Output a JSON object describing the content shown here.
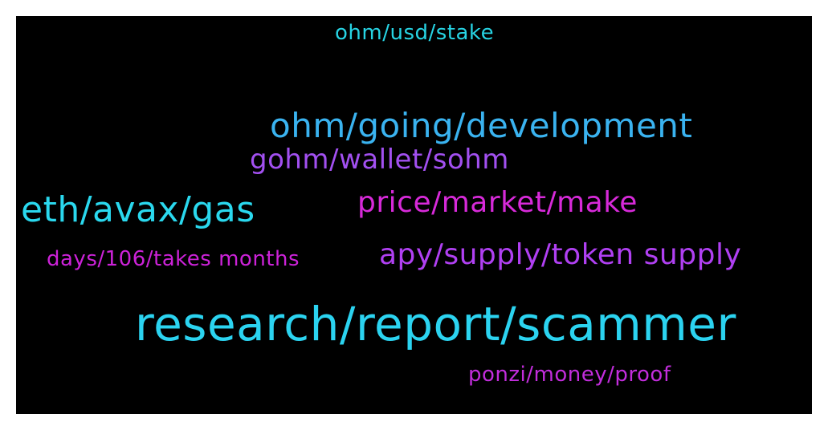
{
  "words": [
    {
      "text": "ohm/usd/stake",
      "color": "#27d3e3"
    },
    {
      "text": "ohm/going/development",
      "color": "#3ab3f0"
    },
    {
      "text": "gohm/wallet/sohm",
      "color": "#a250f0"
    },
    {
      "text": "eth/avax/gas",
      "color": "#2ad8ee"
    },
    {
      "text": "price/market/make",
      "color": "#d72ad9"
    },
    {
      "text": "days/106/takes months",
      "color": "#cc22d8"
    },
    {
      "text": "apy/supply/token supply",
      "color": "#b040f2"
    },
    {
      "text": "research/report/scammer",
      "color": "#2bd3f0"
    },
    {
      "text": "ponzi/money/proof",
      "color": "#c22ddc"
    }
  ]
}
